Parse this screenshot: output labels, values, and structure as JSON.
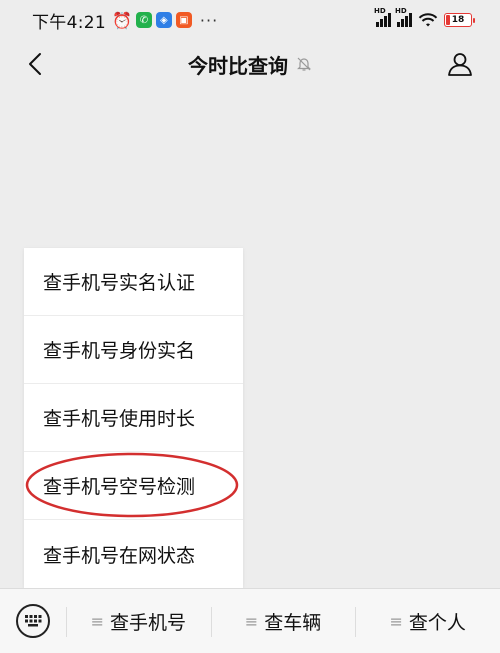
{
  "status_bar": {
    "time": "下午4:21",
    "more": "···",
    "signal_label": "HD",
    "battery": "18"
  },
  "nav": {
    "title": "今时比查询"
  },
  "popup_menu": {
    "items": [
      "查手机号实名认证",
      "查手机号身份实名",
      "查手机号使用时长",
      "查手机号空号检测",
      "查手机号在网状态"
    ],
    "highlighted_index": 3
  },
  "bottom_bar": {
    "tabs": [
      "查手机号",
      "查车辆",
      "查个人"
    ],
    "tab_icon": "≡"
  },
  "colors": {
    "highlight_oval": "#d32f2f",
    "battery_low": "#e53935",
    "background": "#ededed"
  }
}
